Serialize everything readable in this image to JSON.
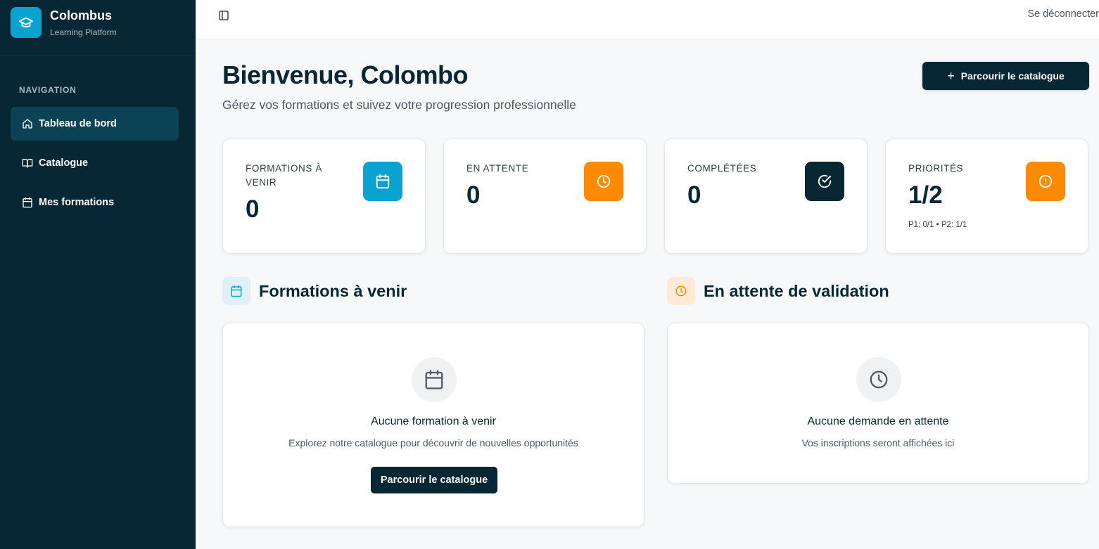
{
  "colors": {
    "sidebar_bg": "#062733",
    "nav_active_bg": "#0b4256",
    "accent_blue": "#0aa3cf",
    "accent_orange": "#ff8a00",
    "dark": "#062733"
  },
  "brand": {
    "name": "Colombus",
    "subtitle": "Learning Platform",
    "icon": "graduation-cap-icon"
  },
  "sidebar": {
    "heading": "NAVIGATION",
    "items": [
      {
        "label": "Tableau de bord",
        "icon": "home-icon",
        "active": true
      },
      {
        "label": "Catalogue",
        "icon": "book-open-icon",
        "active": false
      },
      {
        "label": "Mes formations",
        "icon": "calendar-icon",
        "active": false
      }
    ]
  },
  "topbar": {
    "toggle_icon": "sidebar-toggle-icon",
    "logout_label": "Se déconnecter"
  },
  "header": {
    "title": "Bienvenue, Colombo",
    "subtitle": "Gérez vos formations et suivez votre progression professionnelle",
    "browse_button": "Parcourir le catalogue"
  },
  "stats": [
    {
      "label": "FORMATIONS À VENIR",
      "value": "0",
      "icon": "calendar-icon",
      "color": "#0aa3cf"
    },
    {
      "label": "EN ATTENTE",
      "value": "0",
      "icon": "clock-icon",
      "color": "#ff8a00"
    },
    {
      "label": "COMPLÉTÉES",
      "value": "0",
      "icon": "check-circle-icon",
      "color": "#062733"
    },
    {
      "label": "PRIORITÉS",
      "value": "1/2",
      "note": "P1: 0/1 • P2: 1/1",
      "icon": "alert-circle-icon",
      "color": "#ff8a00"
    }
  ],
  "sections": {
    "upcoming": {
      "title": "Formations à venir",
      "icon": "calendar-icon",
      "empty_title": "Aucune formation à venir",
      "empty_desc": "Explorez notre catalogue pour découvrir de nouvelles opportunités",
      "button": "Parcourir le catalogue"
    },
    "pending": {
      "title": "En attente de validation",
      "icon": "clock-icon",
      "empty_title": "Aucune demande en attente",
      "empty_desc": "Vos inscriptions seront affichées ici"
    }
  }
}
